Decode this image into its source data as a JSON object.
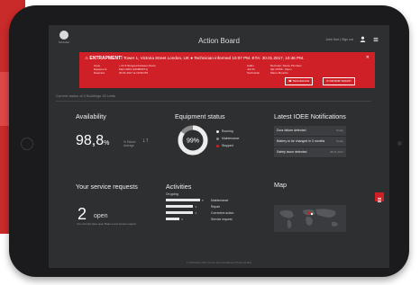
{
  "app": {
    "logo_text": "Schindler",
    "title": "Action Board",
    "user_line": "John Doe  |  Sign out"
  },
  "alert": {
    "label": "ENTRAPMENT!",
    "location": "Tower 1, Victoria Street London, UK",
    "technician_info": "Technician informed 10:07 PM. ETA: 30.01.2017, 10:46 PM.",
    "left_keys": [
      "Issue",
      "Equipment",
      "Detected"
    ],
    "left_values": [
      "+ 01.6 Stopped between floors",
      "Main 0003 (106806671)",
      "30.01.2017 at 10:06 PM"
    ],
    "right_keys": [
      "Caller",
      "Job ID",
      "Technician"
    ],
    "right_values": [
      "Recruiter, Stevie Pinnham",
      "QE 16766 - Open",
      "Marco Bonotto"
    ],
    "btn_technician": "TECHNICIAN",
    "btn_inform": "INFORM TENANT"
  },
  "status_line": "Current status of 4 Buildings 30 Units",
  "availability": {
    "title": "Availability",
    "value": "98,8",
    "unit": "%",
    "note": "% Failure Average"
  },
  "equipment": {
    "title": "Equipment status",
    "value": "99%",
    "running_fraction": 0.85,
    "legend": [
      "Running",
      "Maintenance",
      "Stopped"
    ],
    "colors": {
      "running": "#ededed",
      "maintenance": "#8a8a8a",
      "stopped": "#cf2027"
    }
  },
  "notifications": {
    "title": "Latest IOEE Notifications",
    "items": [
      {
        "text": "Door failure detected",
        "date": "Today"
      },
      {
        "text": "Battery to be changed in 3 months",
        "date": "Today"
      },
      {
        "text": "Safety issue detected",
        "date": "28.01.2017"
      }
    ]
  },
  "service": {
    "title": "Your service requests",
    "count": "2",
    "status": "open",
    "note": "You currently have  open   Make a new service request"
  },
  "activities": {
    "title": "Activities",
    "ongoing_label": "On going",
    "rows": [
      {
        "label": "Maintenance",
        "value": 5
      },
      {
        "label": "Repair",
        "value": 4
      },
      {
        "label": "Corrective action",
        "value": 4
      },
      {
        "label": "Service request",
        "value": 2
      }
    ]
  },
  "map": {
    "title": "Map"
  },
  "footer": "© Schindler 2017    Terms and Conditions    Privacy Policy"
}
